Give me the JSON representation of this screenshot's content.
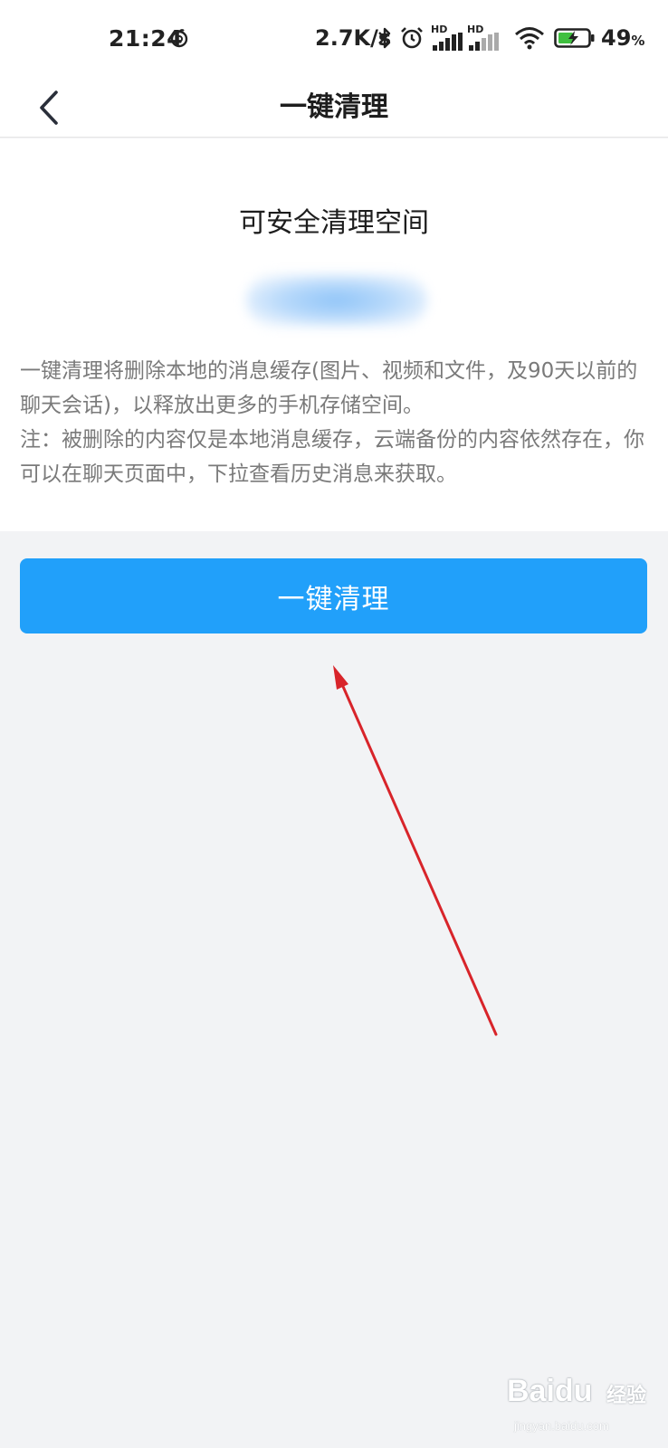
{
  "status_bar": {
    "time": "21:24",
    "network_speed": "2.7K/s",
    "signal_label_1": "HD",
    "signal_label_2": "HD",
    "battery_percent": "49",
    "battery_unit": "%",
    "icons": [
      "netease-music-icon",
      "bluetooth-icon",
      "alarm-icon",
      "signal-icon",
      "wifi-icon",
      "battery-charging-icon"
    ]
  },
  "nav": {
    "title": "一键清理",
    "back_icon": "chevron-left-icon"
  },
  "content": {
    "headline": "可安全清理空间",
    "description_line1": "一键清理将删除本地的消息缓存(图片、视频和文件，及90天以前的聊天会话)，以释放出更多的手机存储空间。",
    "description_line2": "注：被删除的内容仅是本地消息缓存，云端备份的内容依然存在，你可以在聊天页面中，下拉查看历史消息来获取。"
  },
  "actions": {
    "clean_button_label": "一键清理"
  },
  "watermark": {
    "logo": "Baidu",
    "brand": "经验",
    "url": "jingyan.baidu.com"
  },
  "colors": {
    "primary": "#21a0fa",
    "page_background": "#f2f3f5",
    "card_background": "#ffffff",
    "secondary_text": "#7a7a7a",
    "annotation": "#d8242a"
  }
}
